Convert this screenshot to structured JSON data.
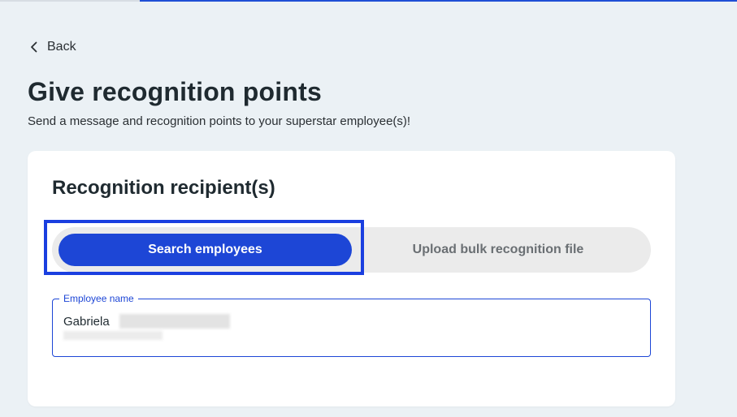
{
  "nav": {
    "back_label": "Back"
  },
  "header": {
    "title": "Give recognition points",
    "subtitle": "Send a message and recognition points to your superstar employee(s)!"
  },
  "recipients": {
    "title": "Recognition recipient(s)",
    "tabs": [
      {
        "label": "Search employees",
        "selected": true
      },
      {
        "label": "Upload bulk recognition file",
        "selected": false
      }
    ],
    "employee_field": {
      "label": "Employee name",
      "value": "Gabriela"
    }
  },
  "colors": {
    "accent": "#1d46d6",
    "focus_ring": "#1a3fe0",
    "background": "#ebf1f5",
    "card": "#ffffff",
    "toggle_track": "#ebebeb"
  },
  "icons": {
    "back": "chevron-left-icon"
  }
}
